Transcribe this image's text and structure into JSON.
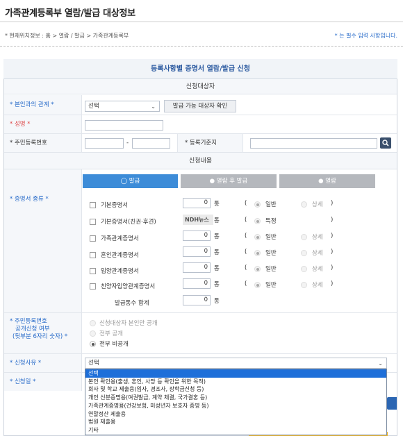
{
  "page": {
    "title": "가족관계등록부 열람/발급 대상정보",
    "location": "* 현재위치정보 : 홈 > 열람 / 발급 > 가족관계등록부",
    "required_note": "* 는 필수 입력 사항입니다."
  },
  "panel": {
    "title": "등록사항별 증명서 열람/발급 신청",
    "section_target": "신청대상자",
    "section_content": "신청내용"
  },
  "fields": {
    "relation_label": "* 본인과의 관계 *",
    "relation_value": "선택",
    "check_button": "발급 가능 대상자 확인",
    "name_label": "* 성명 *",
    "rrn_label": "* 주민등록번호",
    "rrn_dash": "-",
    "base_label": "* 등록기준지"
  },
  "tabs": [
    "발급",
    "열람 후 발급",
    "열람"
  ],
  "cert": {
    "label": "* 증명서 종류 *",
    "unit": "통",
    "paren_open": "(",
    "paren_close": ")",
    "items": [
      {
        "name": "기본증명서",
        "count": "0",
        "opt1": "일반",
        "opt2": "상세"
      },
      {
        "name": "기본증명서(친권·후견)",
        "count": "",
        "opt1": "특정",
        "opt2": ""
      },
      {
        "name": "가족관계증명서",
        "count": "0",
        "opt1": "일반",
        "opt2": "상세"
      },
      {
        "name": "혼인관계증명서",
        "count": "0",
        "opt1": "일반",
        "opt2": "상세"
      },
      {
        "name": "입양관계증명서",
        "count": "0",
        "opt1": "일반",
        "opt2": "상세"
      },
      {
        "name": "친양자입양관계증명서",
        "count": "0",
        "opt1": "일반",
        "opt2": "상세"
      }
    ],
    "total_label": "발급통수 합계",
    "total_value": "0",
    "watermark": "NDH뉴스"
  },
  "rrn_public": {
    "label_line1": "* 주민등록번호",
    "label_line2": "공개신청 여부",
    "label_line3": "(뒷부분 6자리 숫자) *",
    "options": [
      "신청대상자 본인만 공개",
      "전부 공개",
      "전부 비공개"
    ],
    "selected": "전부 비공개"
  },
  "reason": {
    "label": "* 신청사유 *",
    "value": "선택",
    "options": [
      "선택",
      "본인 확인용(출생, 혼인, 사망 등 확인을 위한 목적)",
      "회사 및 학교 제출용(입사, 경조사, 장학금신청 등)",
      "개인 신분증명용(여권발급, 계약 체결, 국가결혼 등)",
      "가족관계증명용(건강보험, 미성년자 보호자 증명 등)",
      "연말정산 제출용",
      "법원 제출용",
      "기타"
    ]
  },
  "date": {
    "label": "* 신청일 *"
  },
  "colors": {
    "accent": "#3d8cd8",
    "label_bg": "#f5f7fa",
    "highlight": "#1e6fd9"
  }
}
